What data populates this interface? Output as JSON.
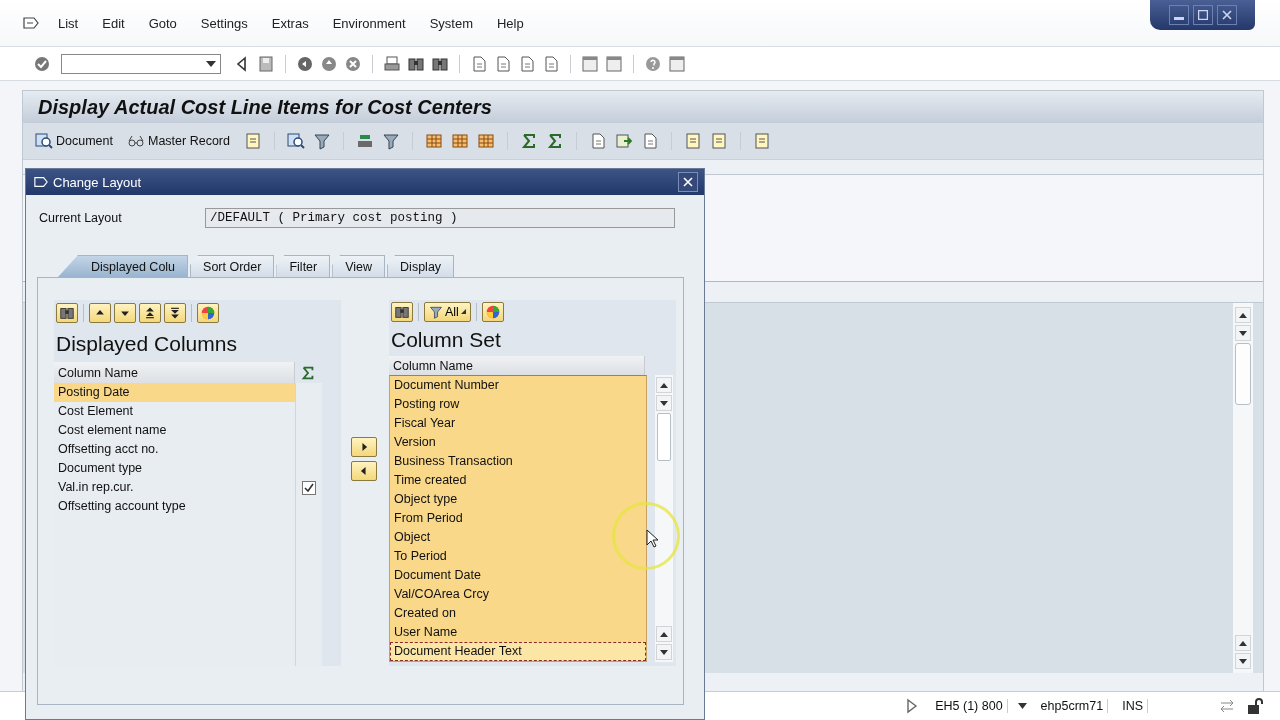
{
  "menu": [
    {
      "label": "List"
    },
    {
      "label": "Edit"
    },
    {
      "label": "Goto"
    },
    {
      "label": "Settings"
    },
    {
      "label": "Extras"
    },
    {
      "label": "Environment"
    },
    {
      "label": "System"
    },
    {
      "label": "Help"
    }
  ],
  "title": "Display Actual Cost Line Items for Cost Centers",
  "app_toolbar": {
    "buttons": [
      "Document",
      "Master Record"
    ]
  },
  "dialog": {
    "title": "Change Layout",
    "current_layout": {
      "label": "Current Layout",
      "value": "/DEFAULT ( Primary cost posting )"
    },
    "tabs": [
      {
        "label": "Displayed Colu",
        "selected": true
      },
      {
        "label": "Sort Order",
        "selected": false
      },
      {
        "label": "Filter",
        "selected": false
      },
      {
        "label": "View",
        "selected": false
      },
      {
        "label": "Display",
        "selected": false
      }
    ],
    "displayed": {
      "heading": "Displayed Columns",
      "column_header": "Column Name",
      "rows": [
        {
          "name": "Posting Date",
          "selected": true
        },
        {
          "name": "Cost Element",
          "selected": false
        },
        {
          "name": "Cost element name",
          "selected": false
        },
        {
          "name": "Offsetting acct no.",
          "selected": false
        },
        {
          "name": "Document type",
          "selected": false
        },
        {
          "name": "Val.in rep.cur.",
          "selected": false,
          "checked": true
        },
        {
          "name": "Offsetting account type",
          "selected": false
        }
      ]
    },
    "column_set": {
      "heading": "Column Set",
      "column_header": "Column Name",
      "filter_label": "All",
      "rows": [
        {
          "name": "Document Number",
          "selected": true,
          "focused": false
        },
        {
          "name": "Posting row",
          "selected": true,
          "focused": false
        },
        {
          "name": "Fiscal Year",
          "selected": true,
          "focused": false
        },
        {
          "name": "Version",
          "selected": true,
          "focused": false
        },
        {
          "name": "Business Transaction",
          "selected": true,
          "focused": false
        },
        {
          "name": "Time created",
          "selected": true,
          "focused": false
        },
        {
          "name": "Object type",
          "selected": true,
          "focused": false
        },
        {
          "name": "From Period",
          "selected": true,
          "focused": false
        },
        {
          "name": "Object",
          "selected": true,
          "focused": false
        },
        {
          "name": "To Period",
          "selected": true,
          "focused": false
        },
        {
          "name": "Document Date",
          "selected": true,
          "focused": false
        },
        {
          "name": "Val/COArea Crcy",
          "selected": true,
          "focused": false
        },
        {
          "name": "Created on",
          "selected": true,
          "focused": false
        },
        {
          "name": "User Name",
          "selected": true,
          "focused": false
        },
        {
          "name": "Document Header Text",
          "selected": true,
          "focused": true
        }
      ]
    }
  },
  "status_bar": {
    "system": "EH5 (1) 800",
    "server": "ehp5crm71",
    "mode": "INS"
  }
}
